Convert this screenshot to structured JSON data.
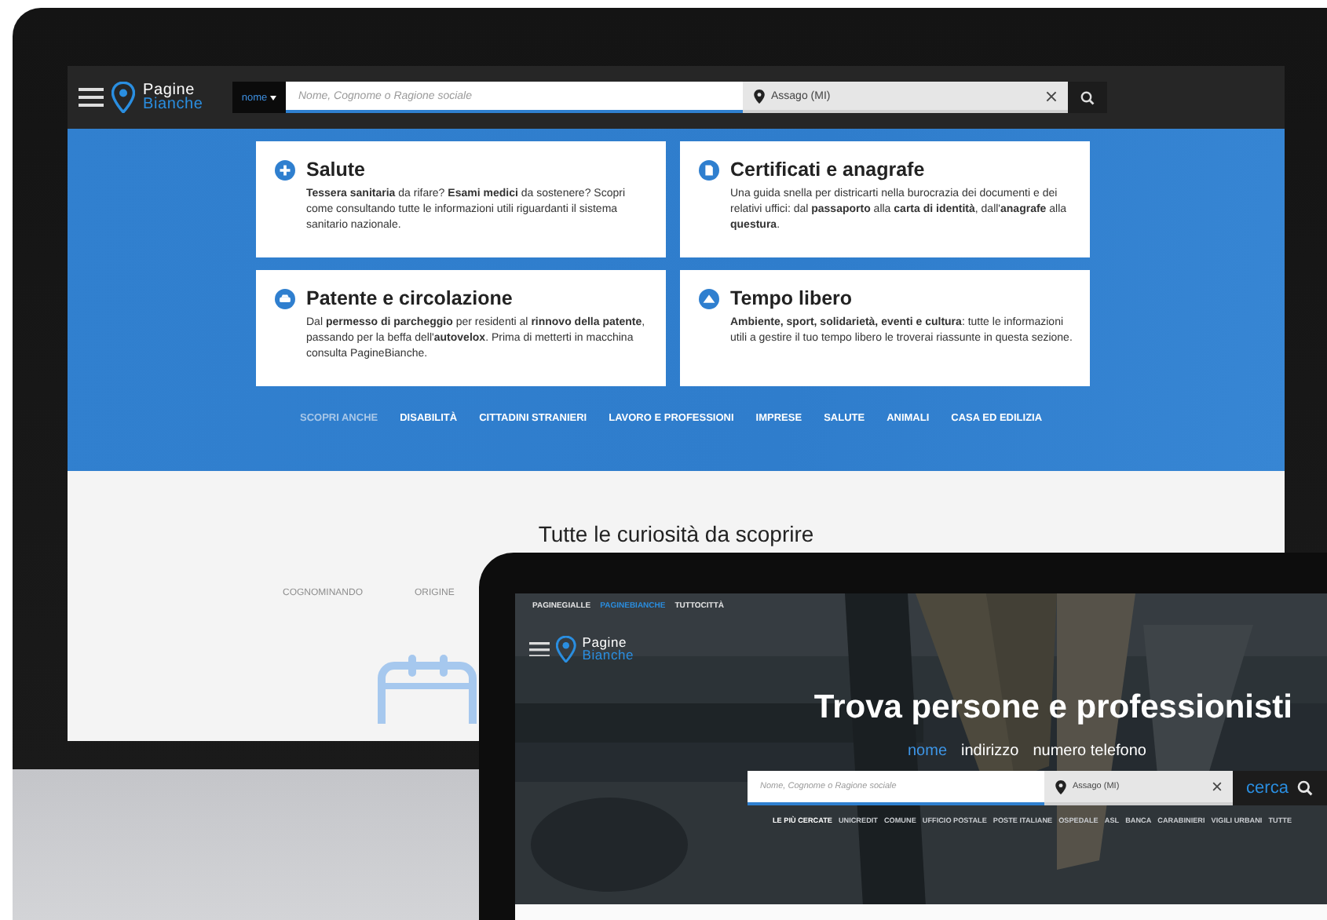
{
  "monitor": {
    "header": {
      "logo": {
        "line_1": "Pagine",
        "line_2": "Bianche"
      },
      "search_type": "nome",
      "search_placeholder": "Nome, Cognome o Ragione sociale",
      "location": "Assago (MI)"
    },
    "cards": [
      {
        "kind": "plus",
        "title": "Salute",
        "text": "**Tessera sanitaria** da rifare? **Esami medici** da sostenere? Scopri come consultando tutte le informazioni utili riguardanti il sistema sanitario nazionale."
      },
      {
        "kind": "document",
        "title": "Certificati e anagrafe",
        "text": "Una guida snella per districarti nella burocrazia dei documenti e dei relativi uffici: dal **passaporto** alla **carta di identità**, dall'**anagrafe** alla **questura**."
      },
      {
        "kind": "car",
        "title": "Patente e circolazione",
        "text": "Dal **permesso di parcheggio** per residenti al **rinnovo della patente**, passando per la beffa dell'**autovelox**. Prima di metterti in macchina consulta PagineBianche."
      },
      {
        "kind": "mountain",
        "title": "Tempo libero",
        "text": "**Ambiente, sport, solidarietà, eventi e cultura**: tutte le informazioni utili a gestire il tuo tempo libero le troverai riassunte in questa sezione."
      }
    ],
    "nav": [
      {
        "kind": "heading",
        "label": "SCOPRI ANCHE"
      },
      {
        "kind": "link",
        "label": "DISABILITÀ"
      },
      {
        "kind": "link",
        "label": "CITTADINI STRANIERI"
      },
      {
        "kind": "link",
        "label": "LAVORO E PROFESSIONI"
      },
      {
        "kind": "link",
        "label": "IMPRESE"
      },
      {
        "kind": "link",
        "label": "SALUTE"
      },
      {
        "kind": "link",
        "label": "ANIMALI"
      },
      {
        "kind": "link",
        "label": "CASA ED EDILIZIA"
      }
    ],
    "section_title": "Tutte le curiosità da scoprire",
    "links": [
      "COGNOMINANDO",
      "ORIGINE"
    ]
  },
  "laptop": {
    "sites": [
      {
        "label": "PAGINEGIALLE",
        "selected": false
      },
      {
        "label": "PAGINEBIANCHE",
        "selected": true
      },
      {
        "label": "TUTTOCITTÀ",
        "selected": false
      }
    ],
    "logo": {
      "line_1": "Pagine",
      "line_2": "Bianche"
    },
    "headline": "Trova persone e professionisti",
    "tabs": [
      {
        "label": "nome",
        "selected": true
      },
      {
        "label": "indirizzo",
        "selected": false
      },
      {
        "label": "numero telefono",
        "selected": false
      }
    ],
    "search_placeholder": "Nome, Cognome o Ragione sociale",
    "location": "Assago (MI)",
    "search_button": "cerca",
    "tags": [
      {
        "kind": "heading",
        "label": "LE PIÙ CERCATE"
      },
      {
        "kind": "link",
        "label": "UNICREDIT"
      },
      {
        "kind": "link",
        "label": "COMUNE"
      },
      {
        "kind": "link",
        "label": "UFFICIO POSTALE"
      },
      {
        "kind": "link",
        "label": "POSTE ITALIANE"
      },
      {
        "kind": "link",
        "label": "OSPEDALE"
      },
      {
        "kind": "link",
        "label": "ASL"
      },
      {
        "kind": "link",
        "label": "BANCA"
      },
      {
        "kind": "link",
        "label": "CARABINIERI"
      },
      {
        "kind": "link",
        "label": "VIGILI URBANI"
      },
      {
        "kind": "link",
        "label": "TUTTE"
      }
    ]
  }
}
